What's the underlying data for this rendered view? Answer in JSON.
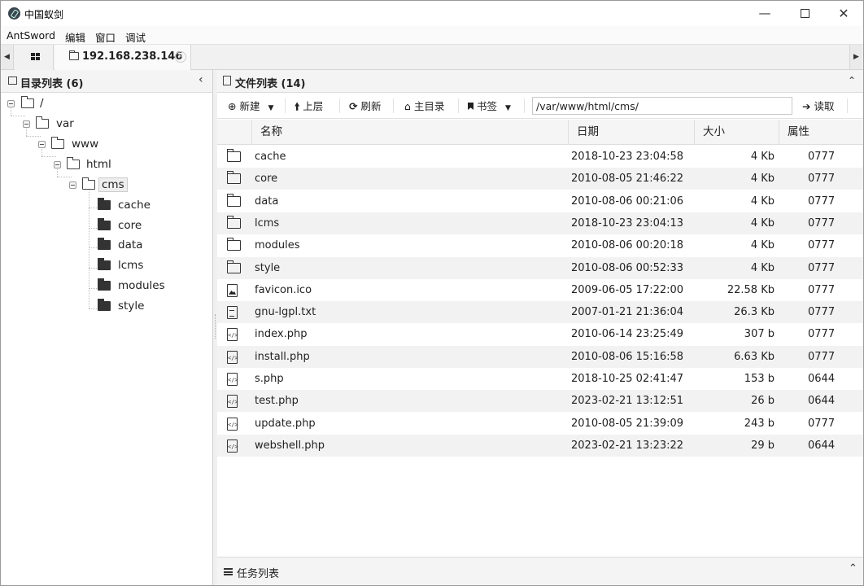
{
  "app": {
    "title": "中国蚁剑"
  },
  "menubar": {
    "items": [
      "AntSword",
      "编辑",
      "窗口",
      "调试"
    ]
  },
  "tabs": {
    "active_label": "192.168.238.146"
  },
  "left_panel": {
    "title": "目录列表 (6)",
    "tree": [
      {
        "label": "/"
      },
      {
        "label": "var"
      },
      {
        "label": "www"
      },
      {
        "label": "html"
      },
      {
        "label": "cms"
      },
      {
        "label": "cache"
      },
      {
        "label": "core"
      },
      {
        "label": "data"
      },
      {
        "label": "lcms"
      },
      {
        "label": "modules"
      },
      {
        "label": "style"
      }
    ]
  },
  "right_panel": {
    "title": "文件列表 (14)",
    "toolbar": {
      "new_label": "新建",
      "up_label": "上层",
      "refresh_label": "刷新",
      "home_label": "主目录",
      "bookmark_label": "书签",
      "path_value": "/var/www/html/cms/",
      "read_label": "读取"
    },
    "columns": [
      "名称",
      "日期",
      "大小",
      "属性"
    ],
    "files": [
      {
        "icon": "folder-icon",
        "name": "cache",
        "date": "2018-10-23 23:04:58",
        "size": "4 Kb",
        "attr": "0777"
      },
      {
        "icon": "folder-icon",
        "name": "core",
        "date": "2010-08-05 21:46:22",
        "size": "4 Kb",
        "attr": "0777"
      },
      {
        "icon": "folder-icon",
        "name": "data",
        "date": "2010-08-06 00:21:06",
        "size": "4 Kb",
        "attr": "0777"
      },
      {
        "icon": "folder-icon",
        "name": "lcms",
        "date": "2018-10-23 23:04:13",
        "size": "4 Kb",
        "attr": "0777"
      },
      {
        "icon": "folder-icon",
        "name": "modules",
        "date": "2010-08-06 00:20:18",
        "size": "4 Kb",
        "attr": "0777"
      },
      {
        "icon": "folder-icon",
        "name": "style",
        "date": "2010-08-06 00:52:33",
        "size": "4 Kb",
        "attr": "0777"
      },
      {
        "icon": "image-file-icon",
        "name": "favicon.ico",
        "date": "2009-06-05 17:22:00",
        "size": "22.58 Kb",
        "attr": "0777"
      },
      {
        "icon": "text-file-icon",
        "name": "gnu-lgpl.txt",
        "date": "2007-01-21 21:36:04",
        "size": "26.3 Kb",
        "attr": "0777"
      },
      {
        "icon": "code-file-icon",
        "name": "index.php",
        "date": "2010-06-14 23:25:49",
        "size": "307 b",
        "attr": "0777"
      },
      {
        "icon": "code-file-icon",
        "name": "install.php",
        "date": "2010-08-06 15:16:58",
        "size": "6.63 Kb",
        "attr": "0777"
      },
      {
        "icon": "code-file-icon",
        "name": "s.php",
        "date": "2018-10-25 02:41:47",
        "size": "153 b",
        "attr": "0644"
      },
      {
        "icon": "code-file-icon",
        "name": "test.php",
        "date": "2023-02-21 13:12:51",
        "size": "26 b",
        "attr": "0644"
      },
      {
        "icon": "code-file-icon",
        "name": "update.php",
        "date": "2010-08-05 21:39:09",
        "size": "243 b",
        "attr": "0777"
      },
      {
        "icon": "code-file-icon",
        "name": "webshell.php",
        "date": "2023-02-21 13:23:22",
        "size": "29 b",
        "attr": "0644"
      }
    ]
  },
  "task_panel": {
    "title": "任务列表"
  }
}
